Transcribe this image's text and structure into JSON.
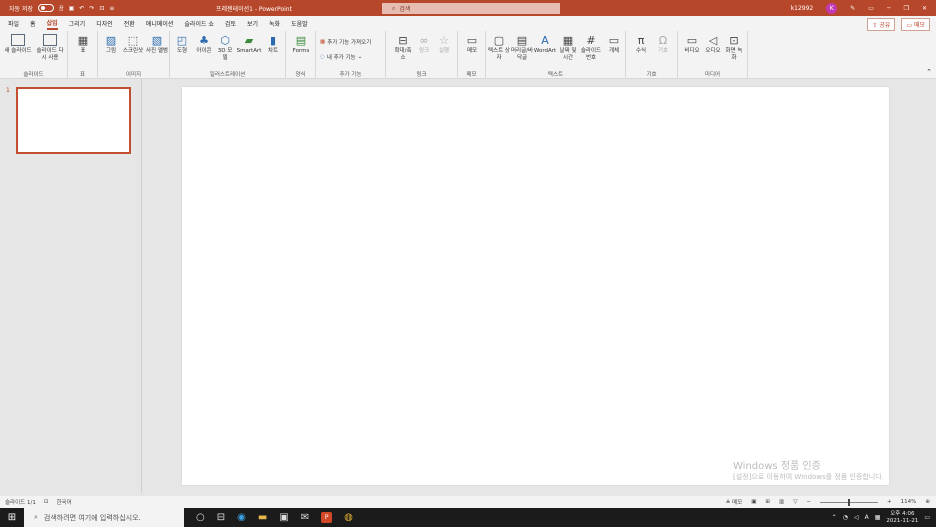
{
  "titlebar": {
    "autosave_label": "자동 저장",
    "autosave_state": "끔",
    "doc_title": "프레젠테이션1 - PowerPoint",
    "search_placeholder": "검색",
    "user_name": "k12992",
    "avatar_initial": "K"
  },
  "tabs": [
    "파일",
    "홈",
    "삽입",
    "그리기",
    "디자인",
    "전환",
    "애니메이션",
    "슬라이드 쇼",
    "검토",
    "보기",
    "녹화",
    "도움말"
  ],
  "active_tab": "삽입",
  "tab_actions": {
    "share": "공유",
    "comment": "메모"
  },
  "ribbon": {
    "slides": {
      "label": "슬라이드",
      "new_slide": "새 슬라이드",
      "reuse": "슬라이드 다시 사용"
    },
    "tables": {
      "label": "표",
      "table": "표"
    },
    "images": {
      "label": "이미지",
      "picture": "그림",
      "screenshot": "스크린샷",
      "album": "사진 앨범"
    },
    "illustrations": {
      "label": "일러스트레이션",
      "shapes": "도형",
      "icons": "아이콘",
      "models3d": "3D 모델",
      "smartart": "SmartArt",
      "chart": "차트"
    },
    "forms": {
      "label": "양식",
      "forms": "Forms"
    },
    "addins": {
      "label": "추가 기능",
      "get": "추가 기능 가져오기",
      "my": "내 추가 기능"
    },
    "links": {
      "label": "링크",
      "zoom": "확대/축소",
      "link": "링크",
      "action": "실행"
    },
    "comments": {
      "label": "메모",
      "comment": "메모"
    },
    "text": {
      "label": "텍스트",
      "textbox": "텍스트 상자",
      "header": "머리글/바닥글",
      "wordart": "WordArt",
      "datetime": "날짜 및 시간",
      "slidenum": "슬라이드 번호",
      "object": "개체"
    },
    "symbols": {
      "label": "기호",
      "equation": "수식",
      "symbol": "기호"
    },
    "media": {
      "label": "미디어",
      "video": "비디오",
      "audio": "오디오",
      "record": "화면 녹화"
    }
  },
  "thumbnail": {
    "number": "1"
  },
  "watermark": {
    "line1": "Windows 정품 인증",
    "line2": "[설정]으로 이동하여 Windows를 정품 인증합니다."
  },
  "status": {
    "slide": "슬라이드 1/1",
    "language": "한국어",
    "notes": "메모",
    "zoom": "114%",
    "zoom_level": 1.14
  },
  "taskbar": {
    "search_placeholder": "검색하려면 여기에 입력하십시오.",
    "time": "오후 4:06",
    "date": "2021-11-21",
    "ime": "A"
  },
  "colors": {
    "accent": "#b7472a",
    "ribbon_bg": "#f3f3f3",
    "workspace_bg": "#e6e6e6",
    "taskbar_bg": "#1b1b1b"
  }
}
